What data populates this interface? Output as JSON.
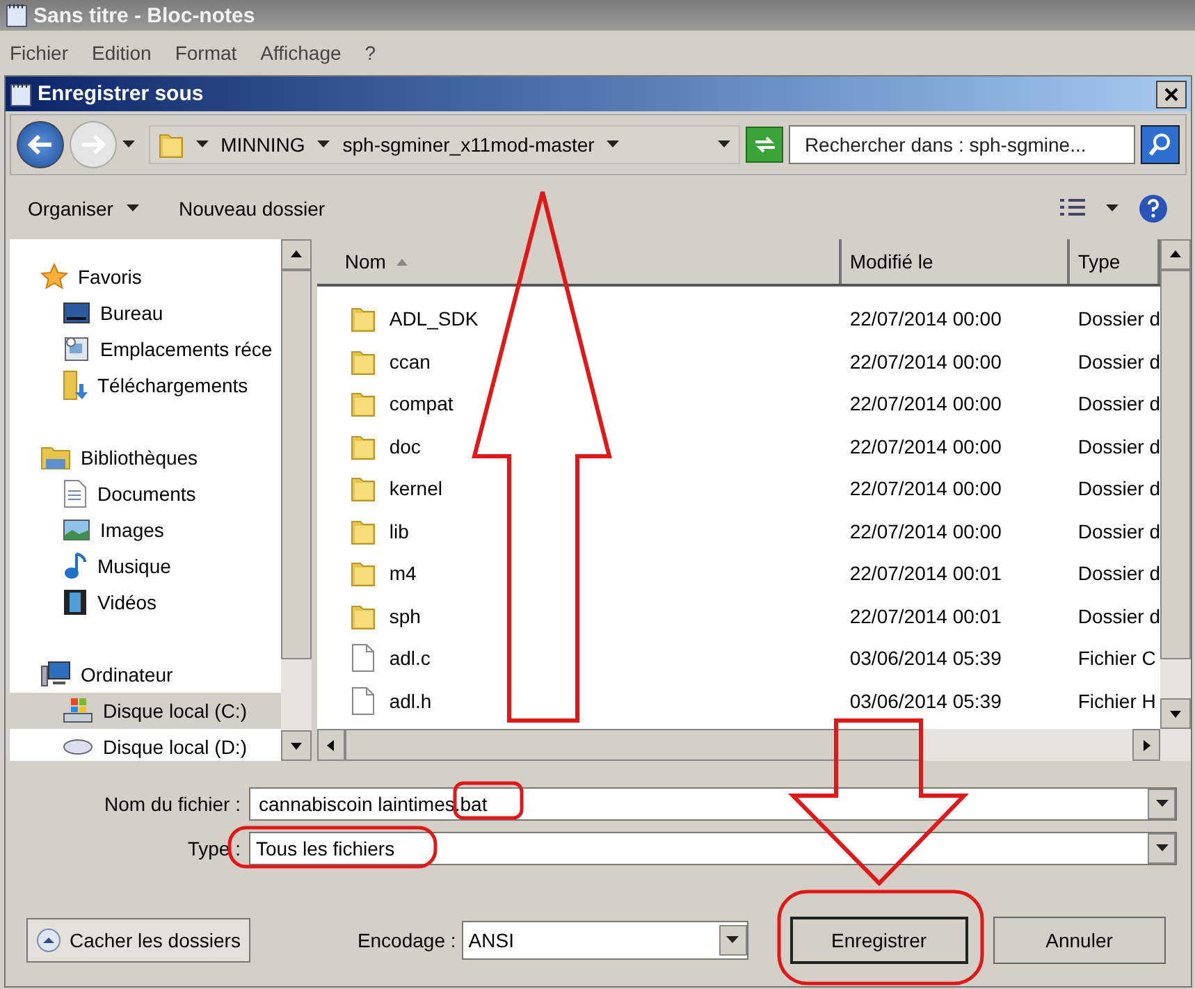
{
  "notepad": {
    "title": "Sans titre - Bloc-notes",
    "menu": [
      "Fichier",
      "Edition",
      "Format",
      "Affichage",
      "?"
    ]
  },
  "dialog": {
    "title": "Enregistrer sous",
    "breadcrumb": [
      "MINNING",
      "sph-sgminer_x11mod-master"
    ],
    "search": {
      "placeholder": "Rechercher dans : sph-sgmine..."
    },
    "organize": "Organiser",
    "new_folder": "Nouveau dossier",
    "nav": [
      {
        "label": "Favoris",
        "children": [
          {
            "label": "Bureau",
            "selected": false
          },
          {
            "label": "Emplacements réce",
            "selected": false
          },
          {
            "label": "Téléchargements",
            "selected": false
          }
        ]
      },
      {
        "label": "Bibliothèques",
        "children": [
          {
            "label": "Documents",
            "selected": false
          },
          {
            "label": "Images",
            "selected": false
          },
          {
            "label": "Musique",
            "selected": false
          },
          {
            "label": "Vidéos",
            "selected": false
          }
        ]
      },
      {
        "label": "Ordinateur",
        "children": [
          {
            "label": "Disque local (C:)",
            "selected": true
          },
          {
            "label": "Disque local (D:)",
            "selected": false
          }
        ]
      }
    ],
    "columns": [
      {
        "label": "Nom",
        "sorted": true
      },
      {
        "label": "Modifié le",
        "sorted": false
      },
      {
        "label": "Type",
        "sorted": false
      }
    ],
    "files": [
      {
        "kind": "folder",
        "name": "ADL_SDK",
        "modified": "22/07/2014 00:00",
        "type": "Dossier d"
      },
      {
        "kind": "folder",
        "name": "ccan",
        "modified": "22/07/2014 00:00",
        "type": "Dossier d"
      },
      {
        "kind": "folder",
        "name": "compat",
        "modified": "22/07/2014 00:00",
        "type": "Dossier d"
      },
      {
        "kind": "folder",
        "name": "doc",
        "modified": "22/07/2014 00:00",
        "type": "Dossier d"
      },
      {
        "kind": "folder",
        "name": "kernel",
        "modified": "22/07/2014 00:00",
        "type": "Dossier d"
      },
      {
        "kind": "folder",
        "name": "lib",
        "modified": "22/07/2014 00:00",
        "type": "Dossier d"
      },
      {
        "kind": "folder",
        "name": "m4",
        "modified": "22/07/2014 00:01",
        "type": "Dossier d"
      },
      {
        "kind": "folder",
        "name": "sph",
        "modified": "22/07/2014 00:01",
        "type": "Dossier d"
      },
      {
        "kind": "file",
        "name": "adl.c",
        "modified": "03/06/2014 05:39",
        "type": "Fichier C"
      },
      {
        "kind": "file",
        "name": "adl.h",
        "modified": "03/06/2014 05:39",
        "type": "Fichier H"
      }
    ],
    "filename": {
      "label": "Nom du fichier :",
      "value": "cannabiscoin laintimes.bat"
    },
    "filetype": {
      "label": "Type :",
      "value": "Tous les fichiers"
    },
    "hide_folders": "Cacher les dossiers",
    "encoding": {
      "label": "Encodage :",
      "value": "ANSI"
    },
    "buttons": [
      {
        "label": "Enregistrer",
        "default": true
      },
      {
        "label": "Annuler",
        "default": false
      }
    ]
  },
  "annotations": [
    {
      "kind": "arrow-up"
    },
    {
      "kind": "arrow-down"
    },
    {
      "kind": "ellipse"
    },
    {
      "kind": "ellipse"
    },
    {
      "kind": "ellipse"
    }
  ]
}
